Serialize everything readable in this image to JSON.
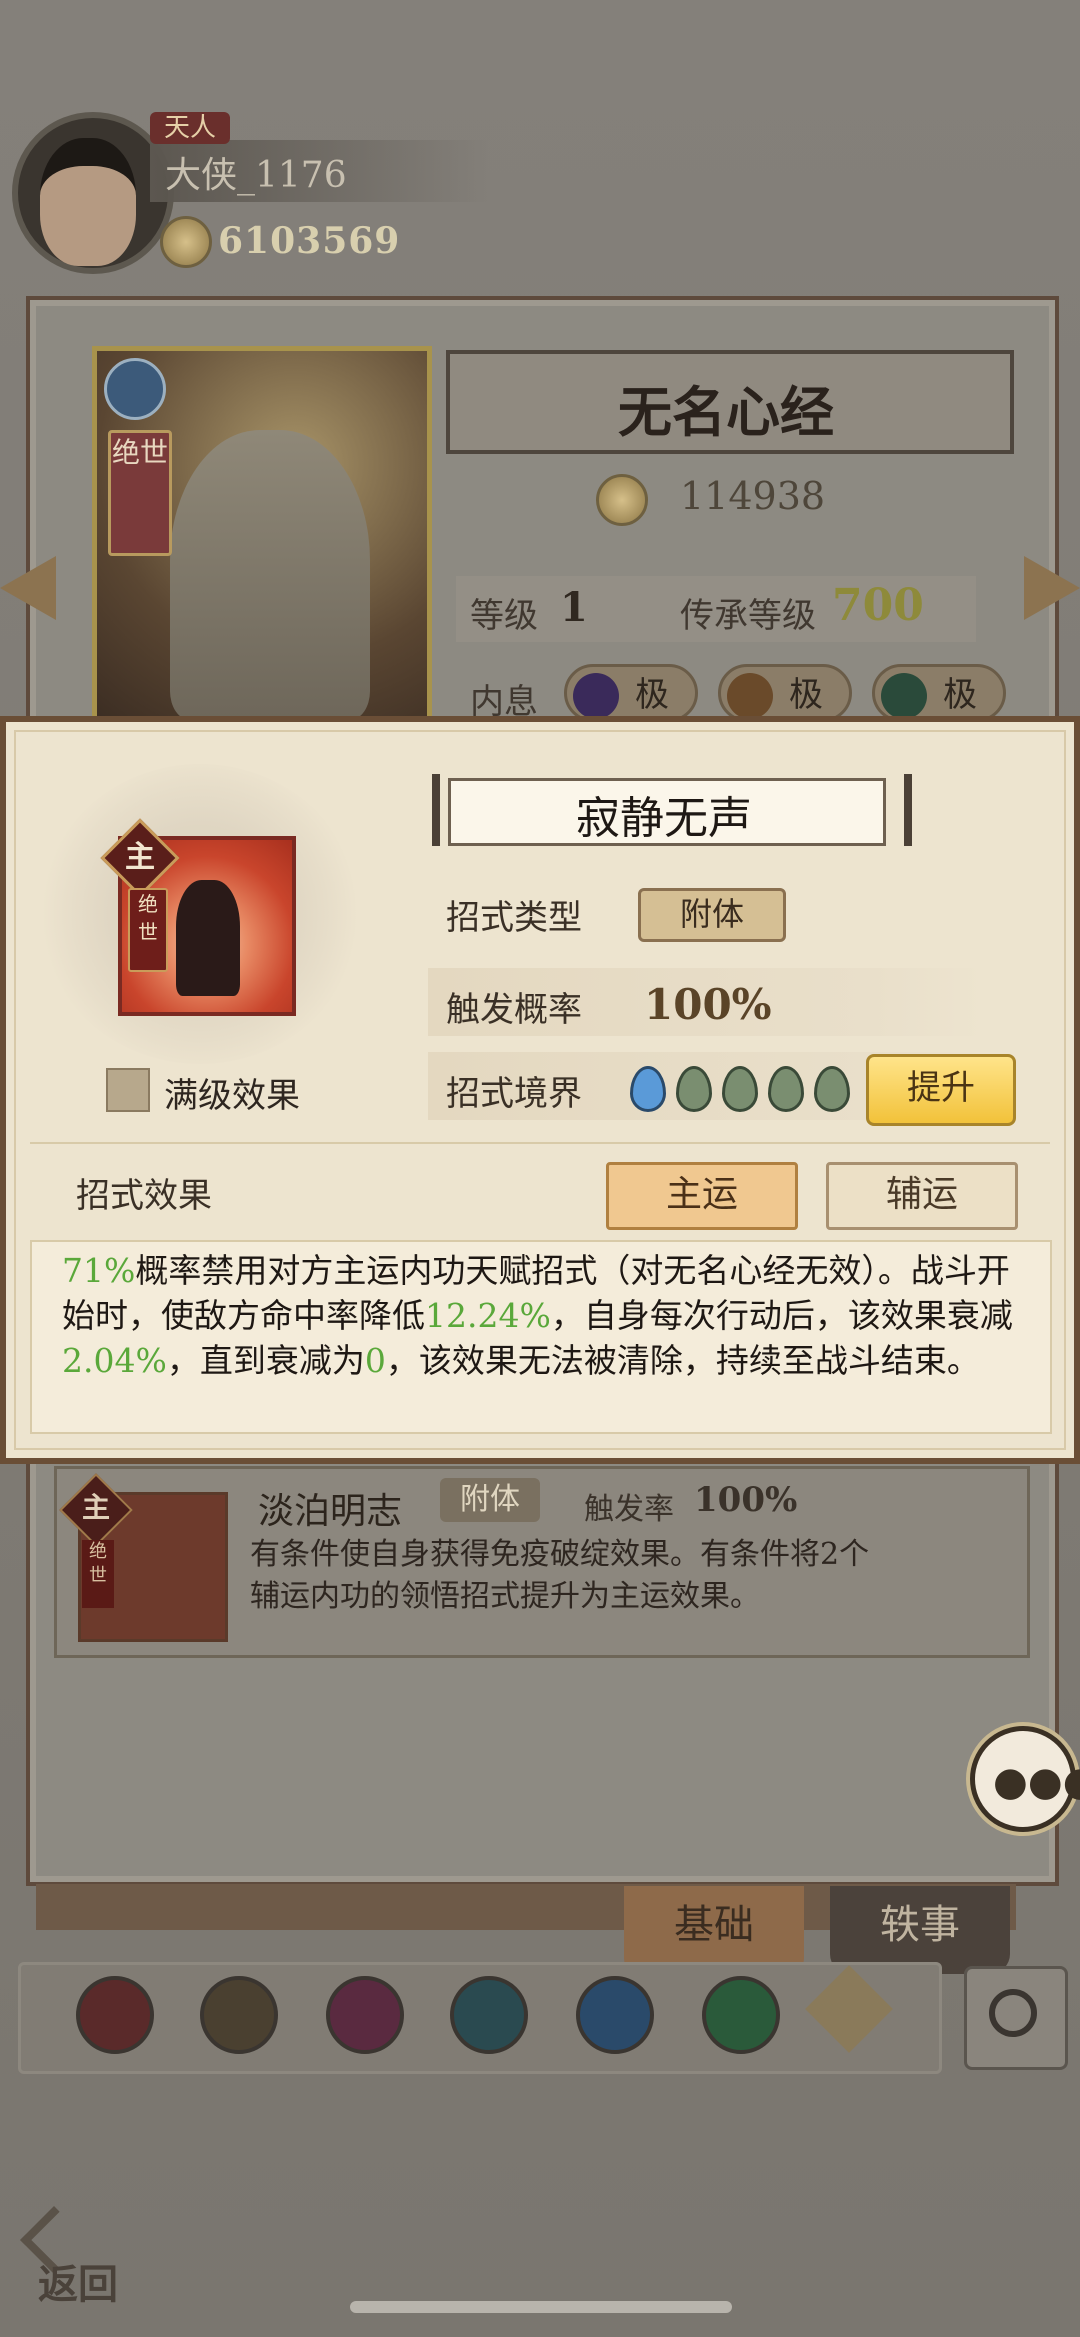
{
  "player": {
    "title": "天人",
    "name": "大侠_1176",
    "coins": "6103569"
  },
  "background_card": {
    "tier": "绝世",
    "manual_name": "无名心经",
    "power": "114938",
    "level_label": "等级",
    "level": "1",
    "inherit_label": "传承等级",
    "inherit_level": "700",
    "neixi_label": "内息",
    "neixi_pills": [
      "极",
      "极",
      "极"
    ]
  },
  "popup": {
    "skill_name": "寂静无声",
    "main_badge": "主",
    "tier": "绝世",
    "max_effect_label": "满级效果",
    "type_label": "招式类型",
    "type_value": "附体",
    "trigger_label": "触发概率",
    "trigger_value": "100%",
    "realm_label": "招式境界",
    "upgrade_label": "提升",
    "effect_label": "招式效果",
    "main_btn": "主运",
    "aux_btn": "辅运",
    "desc": {
      "p1": "71%",
      "t1": "概率禁用对方主运内功天赋招式（对无名心经无效）。战斗开始时，使敌方命中率降低",
      "p2": "12.24%",
      "t2": "，自身每次行动后，该效果衰减",
      "p3": "2.04%",
      "t3": "，直到衰减为",
      "p4": "0",
      "t4": "，该效果无法被清除，持续至战斗结束。"
    }
  },
  "move_card": {
    "badge": "主",
    "tier": "绝世",
    "name": "淡泊明志",
    "type": "附体",
    "trigger_label": "触发率",
    "trigger_value": "100%",
    "desc": "有条件使自身获得免疫破绽效果。有条件将2个辅运内功的领悟招式提升为主运效果。"
  },
  "tabs": {
    "basic": "基础",
    "anecdote": "轶事"
  },
  "back_label": "返回",
  "colors": {
    "highlight_green": "#5aa83a",
    "upgrade_gold": "#f2c23a",
    "main_btn": "#f0c890"
  }
}
